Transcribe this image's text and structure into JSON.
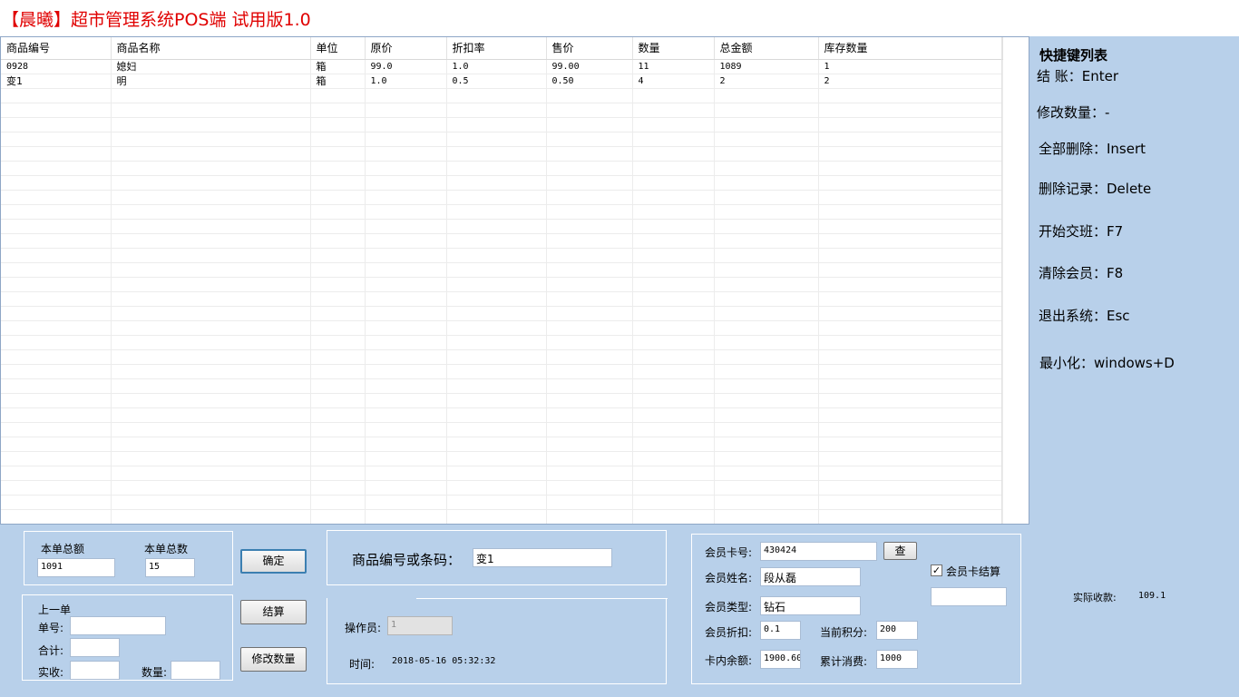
{
  "window": {
    "title": "【晨曦】超市管理系统POS端 试用版1.0"
  },
  "grid": {
    "columns": [
      "商品编号",
      "商品名称",
      "单位",
      "原价",
      "折扣率",
      "售价",
      "数量",
      "总金额",
      "库存数量"
    ],
    "rows": [
      [
        "0928",
        "媳妇",
        "箱",
        "99.0",
        "1.0",
        "99.00",
        "11",
        "1089",
        "1"
      ],
      [
        "变1",
        "明",
        "箱",
        "1.0",
        "0.5",
        "0.50",
        "4",
        "2",
        "2"
      ]
    ]
  },
  "shortcuts": {
    "header": "快捷键列表",
    "items": [
      "结 账：Enter",
      "修改数量：-",
      "全部删除：Insert",
      "删除记录：Delete",
      "开始交班：F7",
      "清除会员：F8",
      "退出系统：Esc",
      "最小化：windows+D"
    ]
  },
  "order_totals": {
    "amount_label": "本单总额",
    "amount_value": "1091",
    "count_label": "本单总数",
    "count_value": "15"
  },
  "previous_order": {
    "title": "上一单",
    "order_no_label": "单号:",
    "order_no_value": "",
    "total_label": "合计:",
    "total_value": "",
    "received_label": "实收:",
    "received_value": "",
    "qty_label": "数量:",
    "qty_value": ""
  },
  "buttons": {
    "confirm": "确定",
    "checkout": "结算",
    "modify_qty": "修改数量",
    "lookup": "查"
  },
  "product_entry": {
    "label": "商品编号或条码：",
    "value": "变1"
  },
  "operator": {
    "label": "操作员:",
    "value": "1",
    "time_label": "时间:",
    "time_value": "2018-05-16 05:32:32"
  },
  "member": {
    "card_no_label": "会员卡号:",
    "card_no_value": "430424",
    "name_label": "会员姓名:",
    "name_value": "段从磊",
    "type_label": "会员类型:",
    "type_value": "钻石",
    "discount_label": "会员折扣:",
    "discount_value": "0.1",
    "points_label": "当前积分:",
    "points_value": "200",
    "balance_label": "卡内余额:",
    "balance_value": "1900.60",
    "spent_label": "累计消费:",
    "spent_value": "1000",
    "card_checkout_label": "会员卡结算",
    "card_checkout_checked": true,
    "card_checkout_value": ""
  },
  "actual_payment": {
    "label": "实际收款:",
    "value": "109.1"
  }
}
